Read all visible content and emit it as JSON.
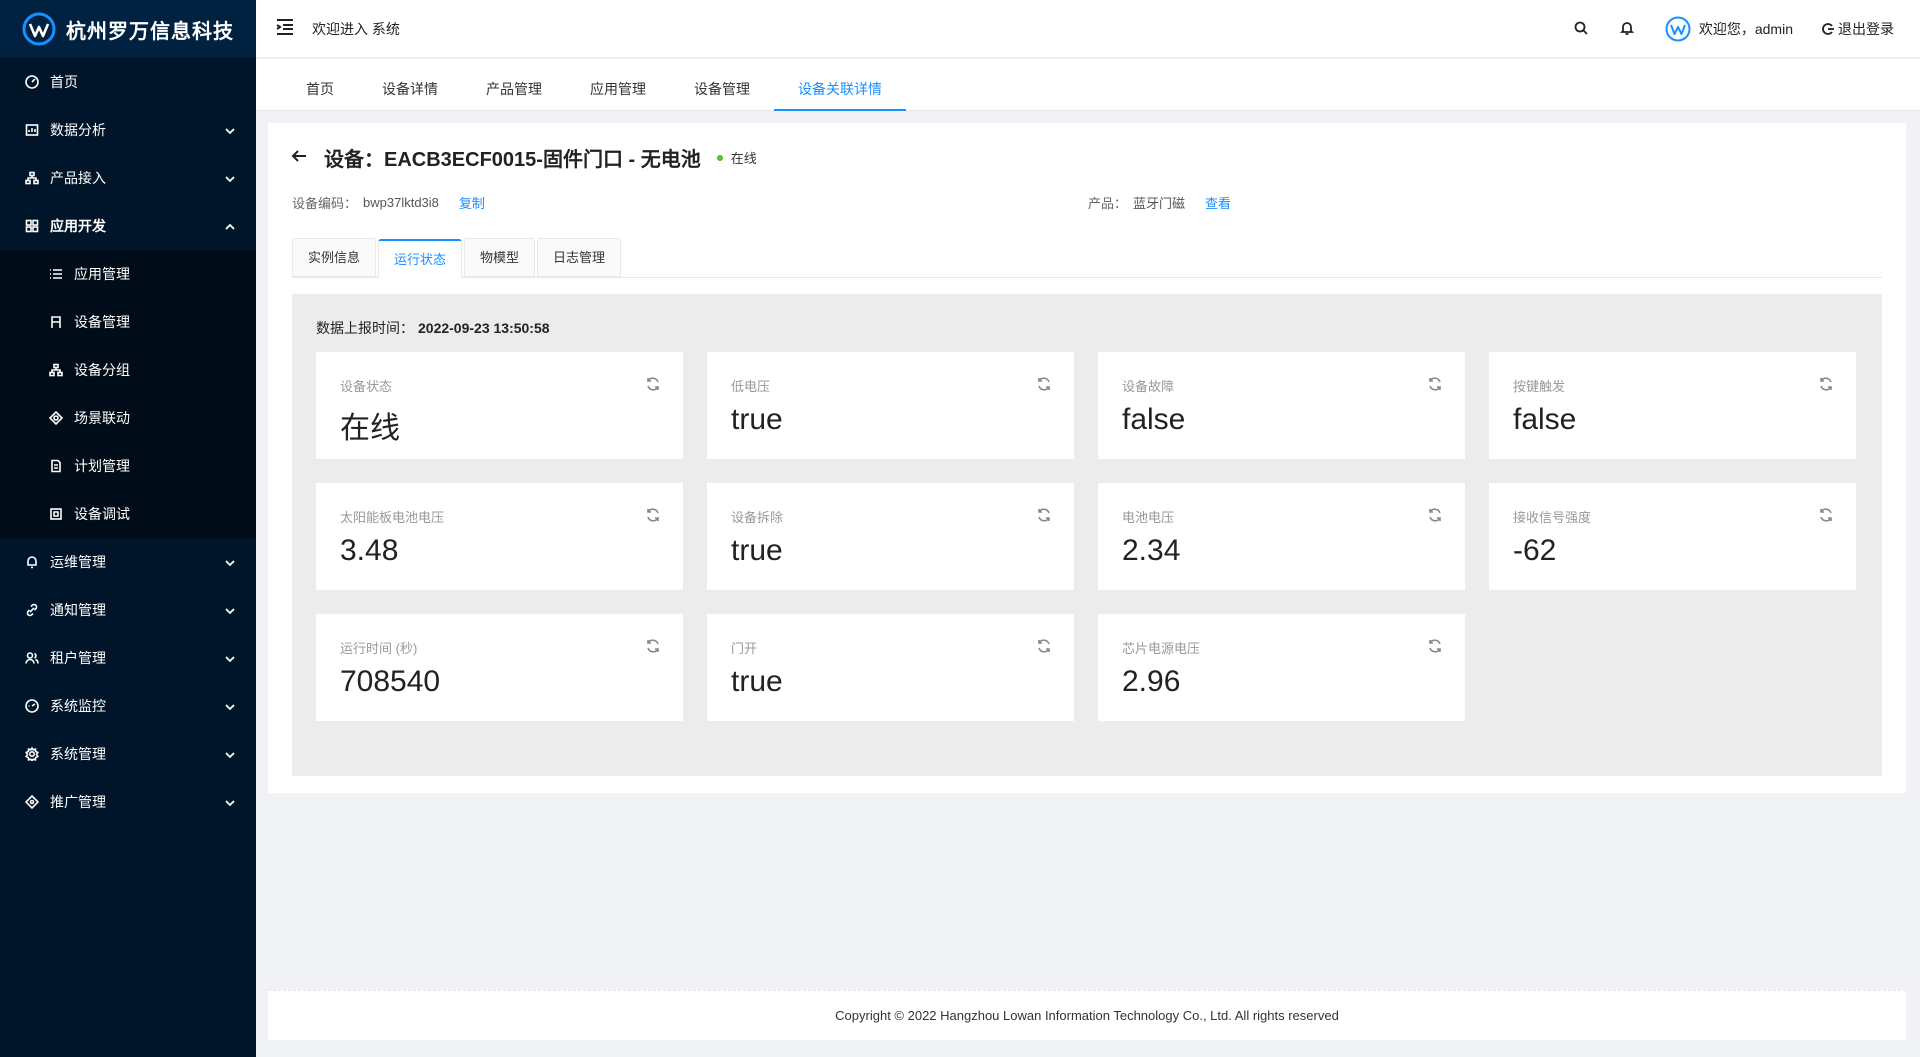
{
  "brand": {
    "name": "杭州罗万信息科技"
  },
  "sidebar": {
    "items": [
      {
        "label": "首页",
        "icon": "dashboard-icon"
      },
      {
        "label": "数据分析",
        "icon": "chart-icon",
        "has_children": true
      },
      {
        "label": "产品接入",
        "icon": "cluster-icon",
        "has_children": true
      },
      {
        "label": "应用开发",
        "icon": "appstore-icon",
        "has_children": true,
        "open": true,
        "children": [
          {
            "label": "应用管理",
            "icon": "list-icon"
          },
          {
            "label": "设备管理",
            "icon": "device-icon"
          },
          {
            "label": "设备分组",
            "icon": "cluster-icon"
          },
          {
            "label": "场景联动",
            "icon": "deployment-icon"
          },
          {
            "label": "计划管理",
            "icon": "file-icon"
          },
          {
            "label": "设备调试",
            "icon": "bug-icon"
          }
        ]
      },
      {
        "label": "运维管理",
        "icon": "alert-icon",
        "has_children": true
      },
      {
        "label": "通知管理",
        "icon": "link-icon",
        "has_children": true
      },
      {
        "label": "租户管理",
        "icon": "team-icon",
        "has_children": true
      },
      {
        "label": "系统监控",
        "icon": "monitor-icon",
        "has_children": true
      },
      {
        "label": "系统管理",
        "icon": "setting-icon",
        "has_children": true
      },
      {
        "label": "推广管理",
        "icon": "promo-icon",
        "has_children": true
      }
    ]
  },
  "header": {
    "welcome": "欢迎进入 系统",
    "user_greeting": "欢迎您，admin",
    "logout": "退出登录"
  },
  "tags": [
    "首页",
    "设备详情",
    "产品管理",
    "应用管理",
    "设备管理",
    "设备关联详情"
  ],
  "active_tag_index": 5,
  "device": {
    "title": "设备：EACB3ECF0015-固件门口 - 无电池",
    "status": "在线",
    "status_color": "#52c41a",
    "code_label": "设备编码：",
    "code_value": "bwp37lktd3i8",
    "copy_label": "复制",
    "product_label": "产品：",
    "product_value": "蓝牙门磁",
    "view_label": "查看"
  },
  "tabs": [
    "实例信息",
    "运行状态",
    "物模型",
    "日志管理"
  ],
  "active_tab_index": 1,
  "running": {
    "report_label": "数据上报时间：",
    "report_time": "2022-09-23 13:50:58",
    "properties": [
      {
        "name": "设备状态",
        "value": "在线"
      },
      {
        "name": "低电压",
        "value": "true"
      },
      {
        "name": "设备故障",
        "value": "false"
      },
      {
        "name": "按键触发",
        "value": "false"
      },
      {
        "name": "太阳能板电池电压",
        "value": "3.48"
      },
      {
        "name": "设备拆除",
        "value": "true"
      },
      {
        "name": "电池电压",
        "value": "2.34"
      },
      {
        "name": "接收信号强度",
        "value": "-62"
      },
      {
        "name": "运行时间 (秒)",
        "value": "708540"
      },
      {
        "name": "门开",
        "value": "true"
      },
      {
        "name": "芯片电源电压",
        "value": "2.96"
      }
    ]
  },
  "footer": {
    "text": "Copyright © 2022 Hangzhou Lowan Information Technology Co., Ltd. All rights reserved"
  },
  "colors": {
    "accent": "#1890ff",
    "sidebar_bg": "#001529",
    "submenu_bg": "#000c17"
  }
}
